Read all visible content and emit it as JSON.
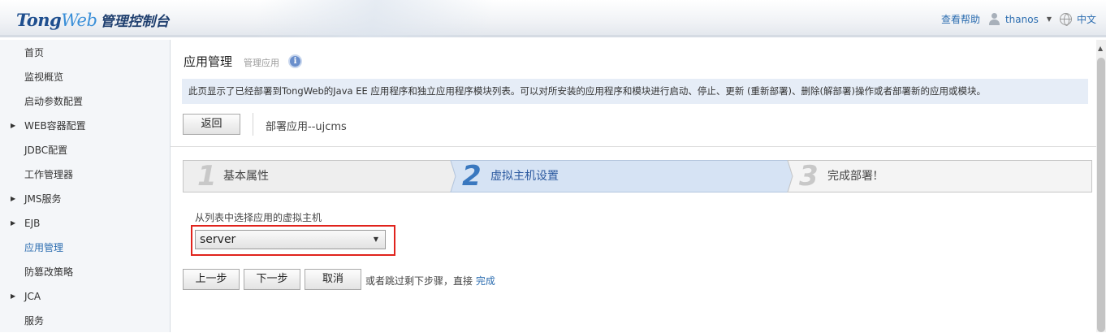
{
  "header": {
    "logo_brand_a": "Tong",
    "logo_brand_b": "Web",
    "logo_sub": "管理控制台",
    "help": "查看帮助",
    "username": "thanos",
    "language": "中文"
  },
  "sidebar": {
    "items": [
      {
        "label": "首页",
        "expandable": false
      },
      {
        "label": "监视概览",
        "expandable": false
      },
      {
        "label": "启动参数配置",
        "expandable": false
      },
      {
        "label": "WEB容器配置",
        "expandable": true
      },
      {
        "label": "JDBC配置",
        "expandable": false
      },
      {
        "label": "工作管理器",
        "expandable": false
      },
      {
        "label": "JMS服务",
        "expandable": true
      },
      {
        "label": "EJB",
        "expandable": true
      },
      {
        "label": "应用管理",
        "expandable": false,
        "active": true
      },
      {
        "label": "防篡改策略",
        "expandable": false
      },
      {
        "label": "JCA",
        "expandable": true
      },
      {
        "label": "服务",
        "expandable": false
      }
    ]
  },
  "main": {
    "title": "应用管理",
    "subtitle": "管理应用",
    "info_icon": "i",
    "description": "此页显示了已经部署到TongWeb的Java EE 应用程序和独立应用程序模块列表。可以对所安装的应用程序和模块进行启动、停止、更新 (重新部署)、删除(解部署)操作或者部署新的应用或模块。",
    "back_label": "返回",
    "deploy_title": "部署应用--ujcms",
    "steps": [
      {
        "number": "1",
        "label": "基本属性",
        "active": false
      },
      {
        "number": "2",
        "label": "虚拟主机设置",
        "active": true
      },
      {
        "number": "3",
        "label": "完成部署!",
        "active": false
      }
    ],
    "field_label": "从列表中选择应用的虚拟主机",
    "select_value": "server",
    "prev_label": "上一步",
    "next_label": "下一步",
    "cancel_label": "取消",
    "skip_text": "或者跳过剩下步骤，直接",
    "skip_link": "完成"
  },
  "colors": {
    "accent": "#2c6db0",
    "highlight_border": "#e0231c",
    "active_step_bg": "#d6e3f4"
  }
}
